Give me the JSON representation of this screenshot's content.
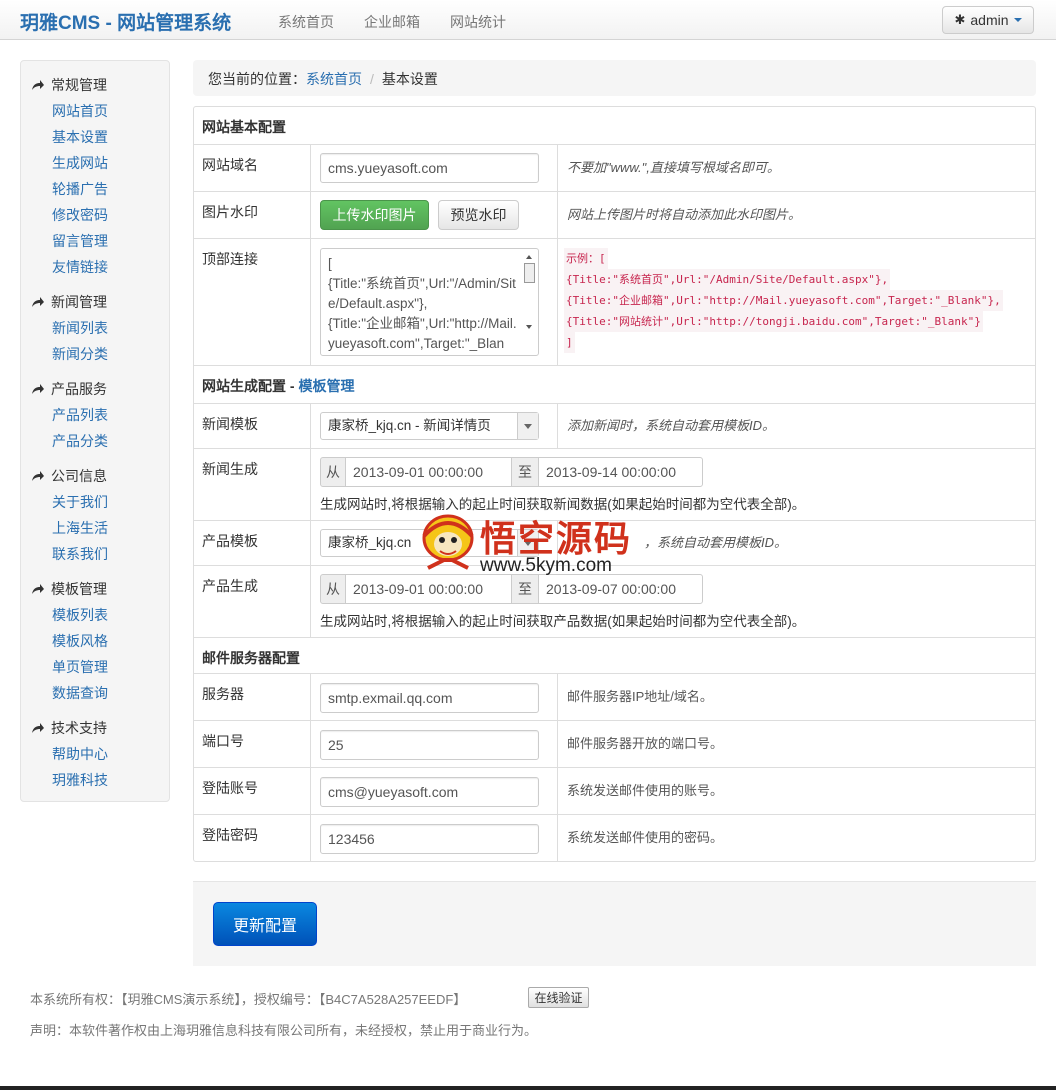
{
  "navbar": {
    "brand": "玥雅CMS - 网站管理系统",
    "links": [
      "系统首页",
      "企业邮箱",
      "网站统计"
    ],
    "user": "admin"
  },
  "sidebar": {
    "groups": [
      {
        "title": "常规管理",
        "items": [
          "网站首页",
          "基本设置",
          "生成网站",
          "轮播广告",
          "修改密码",
          "留言管理",
          "友情链接"
        ]
      },
      {
        "title": "新闻管理",
        "items": [
          "新闻列表",
          "新闻分类"
        ]
      },
      {
        "title": "产品服务",
        "items": [
          "产品列表",
          "产品分类"
        ]
      },
      {
        "title": "公司信息",
        "items": [
          "关于我们",
          "上海生活",
          "联系我们"
        ]
      },
      {
        "title": "模板管理",
        "items": [
          "模板列表",
          "模板风格",
          "单页管理",
          "数据查询"
        ]
      },
      {
        "title": "技术支持",
        "items": [
          "帮助中心",
          "玥雅科技"
        ]
      }
    ]
  },
  "breadcrumb": {
    "prefix": "您当前的位置：",
    "home": "系统首页",
    "current": "基本设置"
  },
  "basic": {
    "section_title": "网站基本配置",
    "domain": {
      "label": "网站域名",
      "value": "cms.yueyasoft.com",
      "hint": "不要加\"www.\",直接填写根域名即可。"
    },
    "watermark": {
      "label": "图片水印",
      "upload_button": "上传水印图片",
      "preview_button": "预览水印",
      "hint": "网站上传图片时将自动添加此水印图片。"
    },
    "toplinks": {
      "label": "顶部连接",
      "value": "[\n{Title:\"系统首页\",Url:\"/Admin/Site/Default.aspx\"},\n{Title:\"企业邮箱\",Url:\"http://Mail.yueyasoft.com\",Target:\"_Blank\"},",
      "example_lines": [
        "示例：[",
        "{Title:\"系统首页\",Url:\"/Admin/Site/Default.aspx\"},",
        "{Title:\"企业邮箱\",Url:\"http://Mail.yueyasoft.com\",Target:\"_Blank\"},",
        "{Title:\"网站统计\",Url:\"http://tongji.baidu.com\",Target:\"_Blank\"}",
        "]"
      ]
    }
  },
  "generate": {
    "section_title": "网站生成配置 - ",
    "section_link": "模板管理",
    "news_template": {
      "label": "新闻模板",
      "value": "康家桥_kjq.cn - 新闻详情页",
      "hint": "添加新闻时，系统自动套用模板ID。"
    },
    "news_generate": {
      "label": "新闻生成",
      "from": "从",
      "to": "至",
      "start": "2013-09-01 00:00:00",
      "end": "2013-09-14 00:00:00",
      "note": "生成网站时,将根据输入的起止时间获取新闻数据(如果起始时间都为空代表全部)。"
    },
    "product_template": {
      "label": "产品模板",
      "value": "康家桥_kjq.cn",
      "hint": "，系统自动套用模板ID。"
    },
    "product_generate": {
      "label": "产品生成",
      "from": "从",
      "to": "至",
      "start": "2013-09-01 00:00:00",
      "end": "2013-09-07 00:00:00",
      "note": "生成网站时,将根据输入的起止时间获取产品数据(如果起始时间都为空代表全部)。"
    }
  },
  "mail": {
    "section_title": "邮件服务器配置",
    "server": {
      "label": "服务器",
      "value": "smtp.exmail.qq.com",
      "hint": "邮件服务器IP地址/域名。"
    },
    "port": {
      "label": "端口号",
      "value": "25",
      "hint": "邮件服务器开放的端口号。"
    },
    "account": {
      "label": "登陆账号",
      "value": "cms@yueyasoft.com",
      "hint": "系统发送邮件使用的账号。"
    },
    "password": {
      "label": "登陆密码",
      "value": "123456",
      "hint": "系统发送邮件使用的密码。"
    }
  },
  "actions": {
    "submit": "更新配置"
  },
  "footer": {
    "copyright": "本系统所有权：【玥雅CMS演示系统】，授权编号：【B4C7A528A257EEDF】",
    "verify_button": "在线验证",
    "statement": "声明：本软件著作权由上海玥雅信息科技有限公司所有，未经授权，禁止用于商业行为。"
  },
  "watermark_logo": {
    "title": "悟空源码",
    "url": "www.5kym.com"
  },
  "colors": {
    "link": "#2a6fb0",
    "success": "#51a351",
    "primary": "#0051b8",
    "code": "#c7254e"
  }
}
